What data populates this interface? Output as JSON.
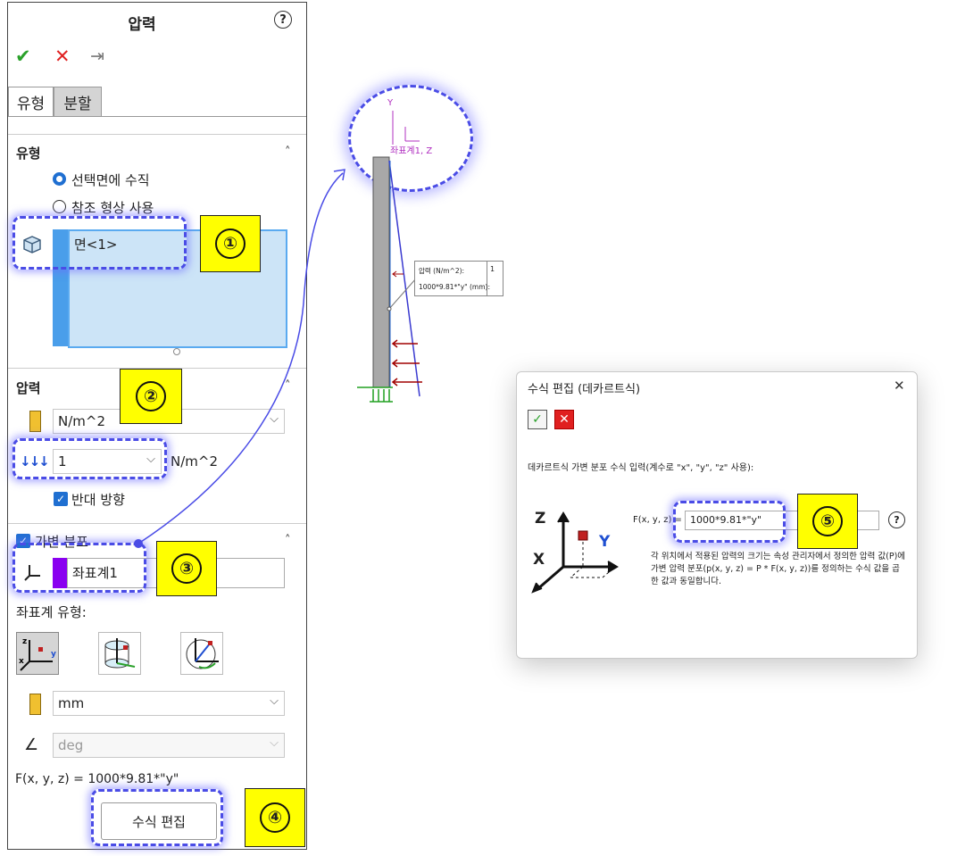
{
  "panel": {
    "title": "압력",
    "help_glyph": "?",
    "toolbar": {
      "ok_glyph": "✔",
      "cancel_glyph": "✕",
      "pin_glyph": "⇥"
    },
    "tabs": [
      {
        "label": "유형"
      },
      {
        "label": "분할"
      }
    ],
    "type_section": {
      "title": "유형",
      "radio_normal": "선택면에 수직",
      "radio_reference": "참조 형상 사용",
      "face_item": "면<1>"
    },
    "pressure_section": {
      "title": "압력",
      "unit_select": "N/m^2",
      "value": "1",
      "value_unit": "N/m^2",
      "reverse_label": "반대 방향"
    },
    "nonuniform_section": {
      "title": "가변 분포",
      "coord_item": "좌표계1",
      "coord_type_label": "좌표계 유형:",
      "length_unit": "mm",
      "angle_unit": "deg",
      "formula_text": "F(x, y, z) = 1000*9.81*\"y\"",
      "edit_button": "수식 편집"
    }
  },
  "badges": [
    "①",
    "②",
    "③",
    "④",
    "⑤"
  ],
  "viewport": {
    "axis_y": "Y",
    "coord_label": "좌표계1, Z",
    "callout_row1_label": "압력 (N/m^2):",
    "callout_row1_value": "1",
    "callout_row2_label": "1000*9.81*\"y\" (mm):"
  },
  "dialog": {
    "title": "수식 편집 (데카르트식)",
    "close_glyph": "✕",
    "ok_glyph": "✓",
    "cancel_glyph": "✕",
    "instruction": "데카르트식 가변 분포 수식 입력(계수로 \"x\", \"y\", \"z\" 사용):",
    "axis_z": "Z",
    "axis_x": "X",
    "axis_y": "Y",
    "fxyz_label": "F(x, y, z) =",
    "formula_value": "1000*9.81*\"y\"",
    "help_glyph": "?",
    "description": "각 위치에서 적용된 압력의 크기는 속성 관리자에서 정의한 압력 값(P)에 가변 압력 분포(p(x, y, z) = P * F(x, y, z))를 정의하는 수식 값을 곱한 값과 동일합니다."
  },
  "colors": {
    "accent": "#1f6fd1",
    "highlight": "#4a4ce6",
    "badge": "#ffff00",
    "purple": "#7a00e6"
  }
}
